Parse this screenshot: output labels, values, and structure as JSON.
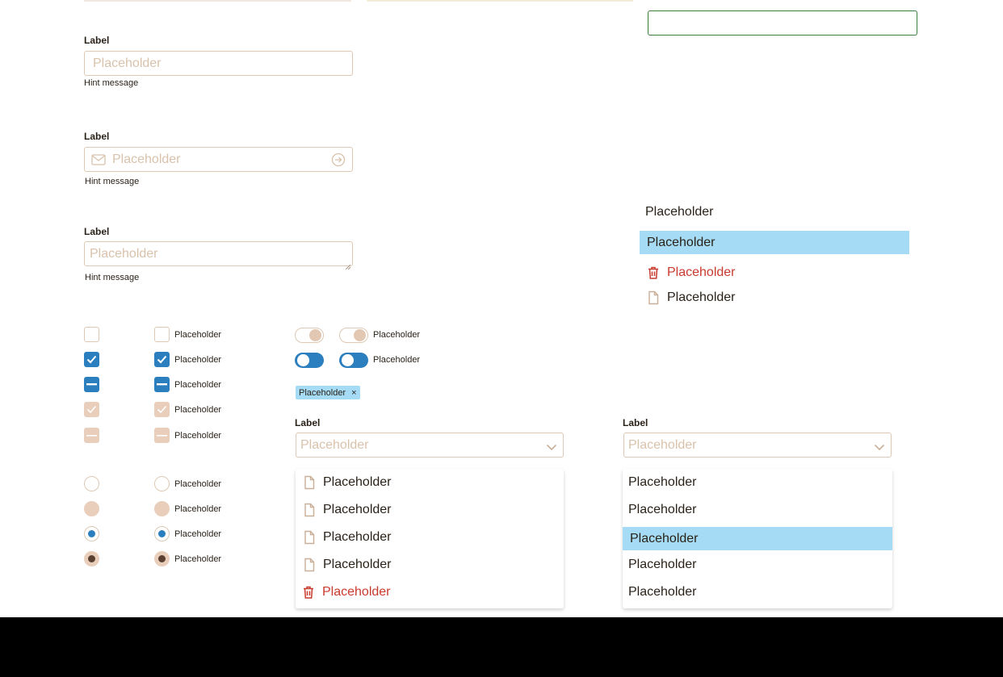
{
  "form": {
    "text_field": {
      "label": "Label",
      "placeholder": "Placeholder",
      "hint": "Hint message"
    },
    "email_field": {
      "label": "Label",
      "placeholder": "Placeholder",
      "hint": "Hint message",
      "left_icon": "mail-icon",
      "right_icon": "arrow-circle-right-icon"
    },
    "textarea": {
      "label": "Label",
      "placeholder": "Placeholder",
      "hint": "Hint message"
    }
  },
  "menu_list": {
    "items": [
      {
        "label": "Placeholder",
        "state": "default"
      },
      {
        "label": "Placeholder",
        "state": "selected"
      },
      {
        "label": "Placeholder",
        "state": "danger",
        "icon": "trash-icon"
      },
      {
        "label": "Placeholder",
        "state": "default",
        "icon": "file-icon"
      }
    ]
  },
  "checkboxes": {
    "label": "Placeholder",
    "states": [
      "unchecked",
      "checked",
      "indeterminate",
      "checked-disabled",
      "indeterminate-disabled"
    ]
  },
  "radios": {
    "label": "Placeholder",
    "states": [
      "unselected",
      "disabled",
      "selected",
      "selected-disabled"
    ]
  },
  "toggles": {
    "label": "Placeholder",
    "states": [
      "off",
      "on"
    ]
  },
  "tag": {
    "label": "Placeholder",
    "remove_glyph": "×"
  },
  "select_left": {
    "label": "Label",
    "placeholder": "Placeholder",
    "options": [
      {
        "label": "Placeholder",
        "icon": "file-icon"
      },
      {
        "label": "Placeholder",
        "icon": "file-icon"
      },
      {
        "label": "Placeholder",
        "icon": "file-icon"
      },
      {
        "label": "Placeholder",
        "icon": "file-icon"
      },
      {
        "label": "Placeholder",
        "icon": "trash-icon",
        "state": "danger"
      }
    ]
  },
  "select_right": {
    "label": "Label",
    "placeholder": "Placeholder",
    "options": [
      {
        "label": "Placeholder"
      },
      {
        "label": "Placeholder"
      },
      {
        "label": "Placeholder",
        "state": "selected"
      },
      {
        "label": "Placeholder"
      },
      {
        "label": "Placeholder"
      }
    ]
  },
  "colors": {
    "border": "#dcc8b3",
    "placeholder": "#d9c2ab",
    "primary": "#2b7fbe",
    "disabled": "#e9cebb",
    "selected_bg": "#a5dbf5",
    "danger": "#c93a2e",
    "focus_border": "#3d7d3d"
  }
}
